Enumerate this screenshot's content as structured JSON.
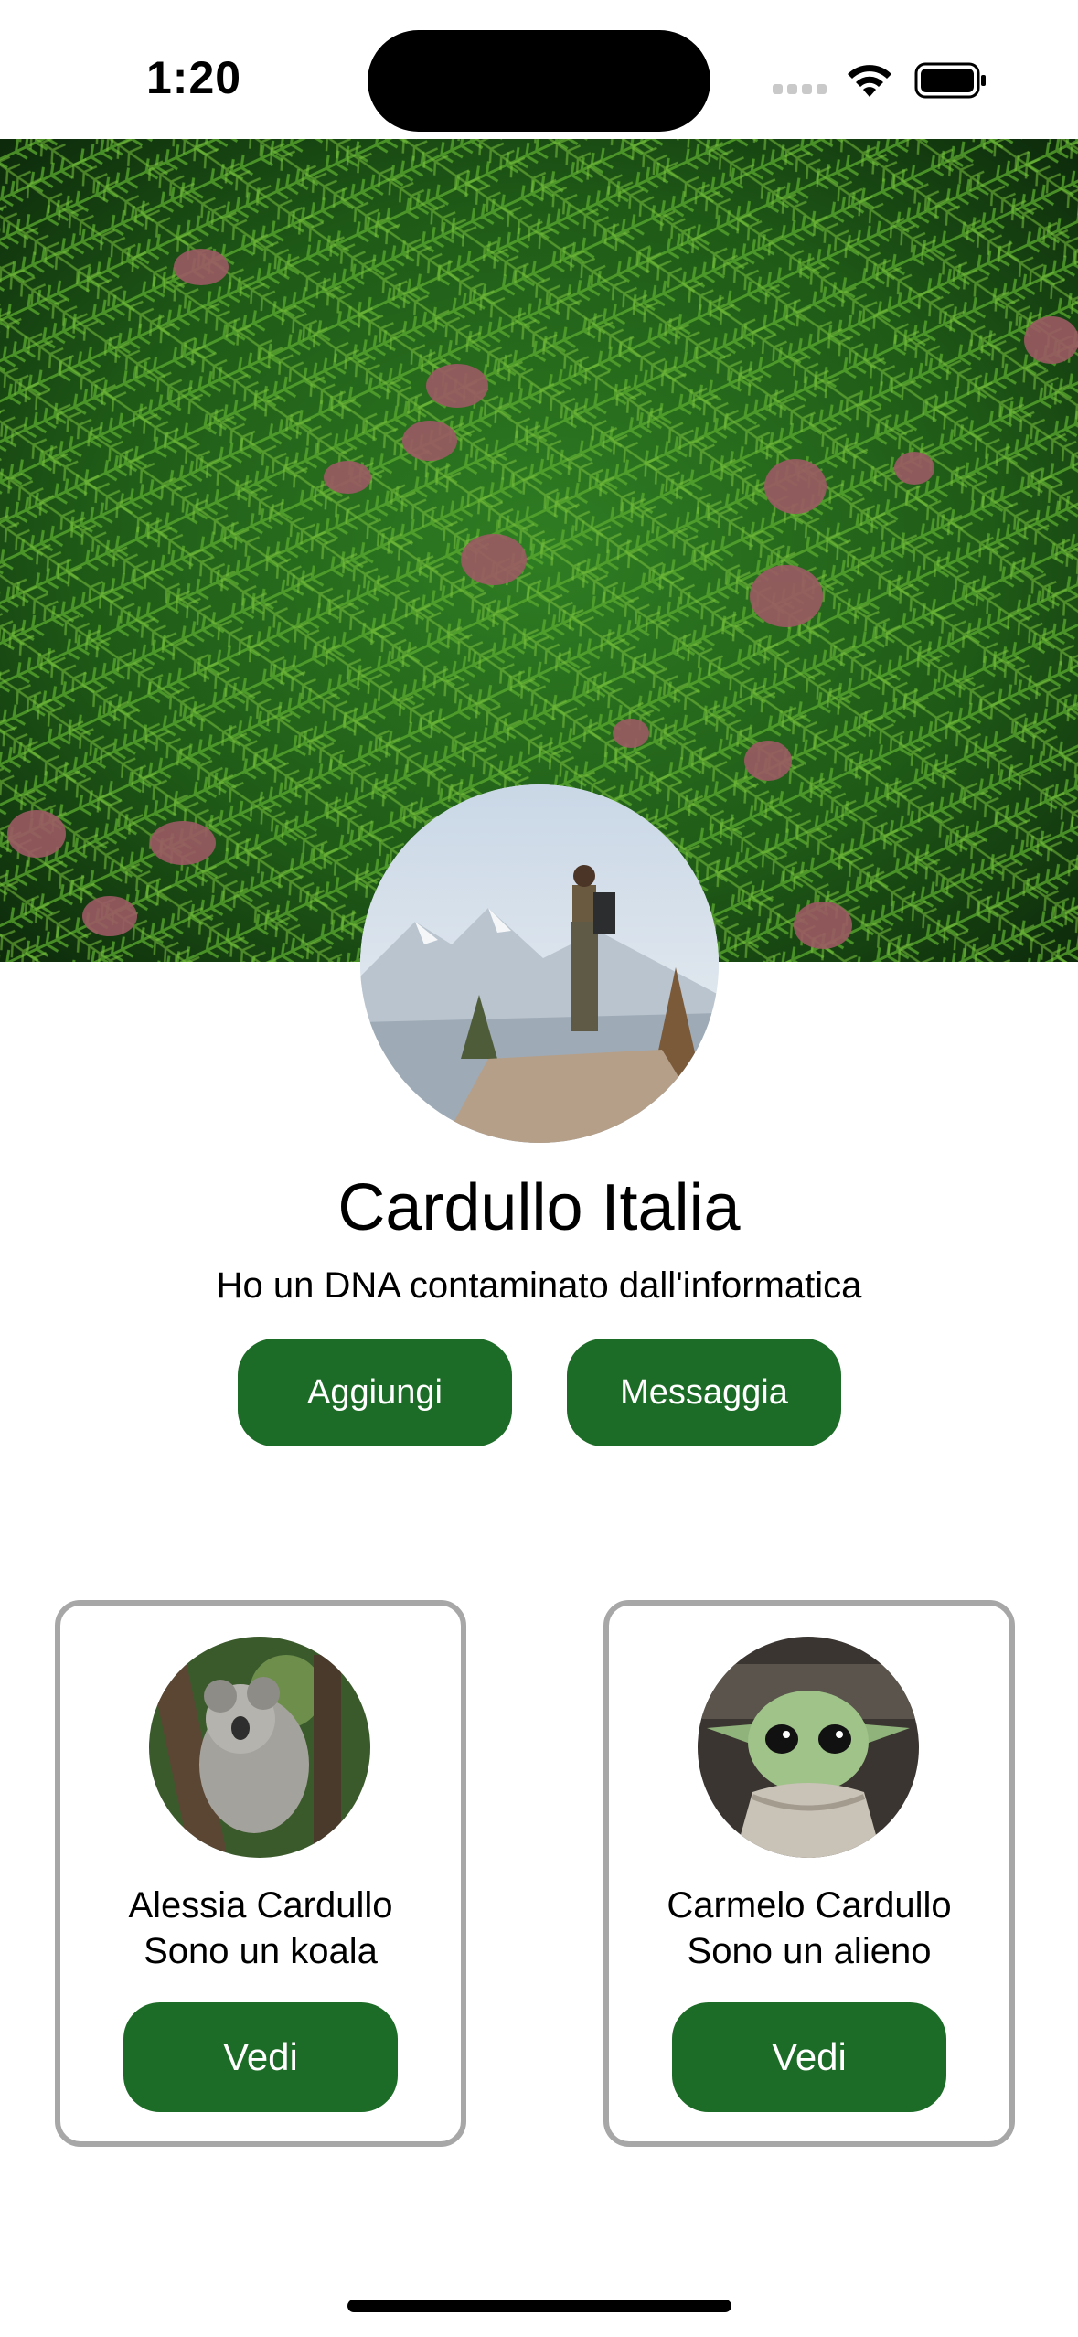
{
  "status_bar": {
    "time": "1:20",
    "icons": [
      "cellular-signal-icon",
      "wifi-icon",
      "battery-icon"
    ]
  },
  "cover": {
    "image": "pine-branches-cover-photo"
  },
  "profile": {
    "avatar_image": "hiker-on-mountain-photo",
    "name": "Cardullo Italia",
    "bio": "Ho un DNA contaminato dall'informatica",
    "add_button": "Aggiungi",
    "message_button": "Messaggia"
  },
  "friends": [
    {
      "image": "koala-photo",
      "name": "Alessia Cardullo",
      "description": "Sono un koala",
      "button": "Vedi"
    },
    {
      "image": "baby-alien-photo",
      "name": "Carmelo Cardullo",
      "description": "Sono un alieno",
      "button": "Vedi"
    }
  ],
  "colors": {
    "accent": "#1c6b26",
    "card_border": "#a7a7a7",
    "background": "#ffffff",
    "text": "#000000"
  }
}
